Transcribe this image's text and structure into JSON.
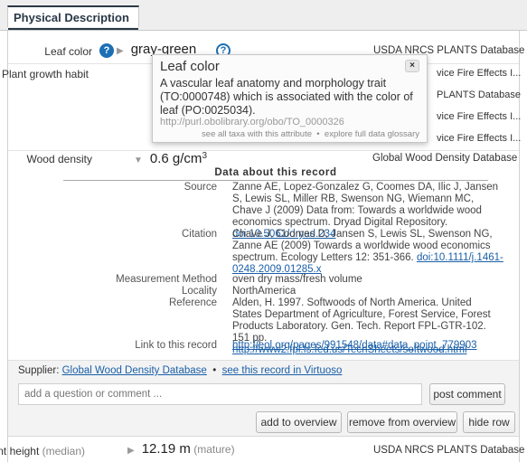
{
  "tab": {
    "title": "Physical Description"
  },
  "rows": {
    "leaf_color": {
      "label": "Leaf color",
      "value": "gray-green",
      "source": "USDA NRCS PLANTS Database"
    },
    "growth_habit": {
      "label": "Plant growth habit",
      "sources": [
        "vice Fire Effects I...",
        "PLANTS Database",
        "vice Fire Effects I...",
        "vice Fire Effects I..."
      ]
    },
    "wood_density": {
      "label": "Wood density",
      "value": "0.6 g/cm",
      "sup": "3",
      "source": "Global Wood Density Database"
    },
    "plant_height": {
      "label": "Plant height",
      "qualifier": "(median)",
      "value": "12.19 m",
      "context": "(mature)",
      "source": "USDA NRCS PLANTS Database"
    }
  },
  "popup": {
    "title": "Leaf color",
    "close": "×",
    "description": "A vascular leaf anatomy and morphology trait (TO:0000748) which is associated with the color of leaf (PO:0025034).",
    "url": "http://purl.obolibrary.org/obo/TO_0000326",
    "link_taxa": "see all taxa with this attribute",
    "separator": "•",
    "link_glossary": "explore full data glossary"
  },
  "record": {
    "heading": "Data about this record",
    "source_label": "Source",
    "source_text": "Zanne AE, Lopez-Gonzalez G, Coomes DA, Ilic J, Jansen S, Lewis SL, Miller RB, Swenson NG, Wiemann MC, Chave J (2009) Data from: Towards a worldwide wood economics spectrum. Dryad Digital Repository.",
    "source_doi": "doi:10.5061/dryad.234",
    "citation_label": "Citation",
    "citation_text": "Chave J, Coomes D, Jansen S, Lewis SL, Swenson NG, Zanne AE (2009) Towards a worldwide wood economics spectrum. Ecology Letters 12: 351-366.",
    "citation_doi": "doi:10.1111/j.1461-0248.2009.01285.x",
    "method_label": "Measurement Method",
    "method_value": "oven dry mass/fresh volume",
    "locality_label": "Locality",
    "locality_value": "NorthAmerica",
    "reference_label": "Reference",
    "reference_text": "Alden, H. 1997. Softwoods of North America. United States Department of Agriculture, Forest Service, Forest Products Laboratory. Gen. Tech. Report FPL-GTR-102. 151 pp.",
    "reference_url": "http://www2.fpl.fs.fed.us/TechSheets/softwood.html",
    "link_label": "Link to this record",
    "link_url": "http://eol.org/pages/991548/data#data_point_779903"
  },
  "supplier": {
    "prefix": "Supplier:",
    "name": "Global Wood Density Database",
    "separator": "•",
    "virtuoso": "see this record in Virtuoso"
  },
  "comment": {
    "placeholder": "add a question or comment ...",
    "post_label": "post comment"
  },
  "actions": {
    "add": "add to overview",
    "remove": "remove from overview",
    "hide": "hide row"
  },
  "colors": {
    "link": "#1a5fa8",
    "qmark": "#1b6fb5",
    "tab_accent": "#2a3846"
  },
  "icons": {
    "help": "question-circle-icon",
    "expand": "triangle-right-icon",
    "collapse": "triangle-down-icon"
  }
}
